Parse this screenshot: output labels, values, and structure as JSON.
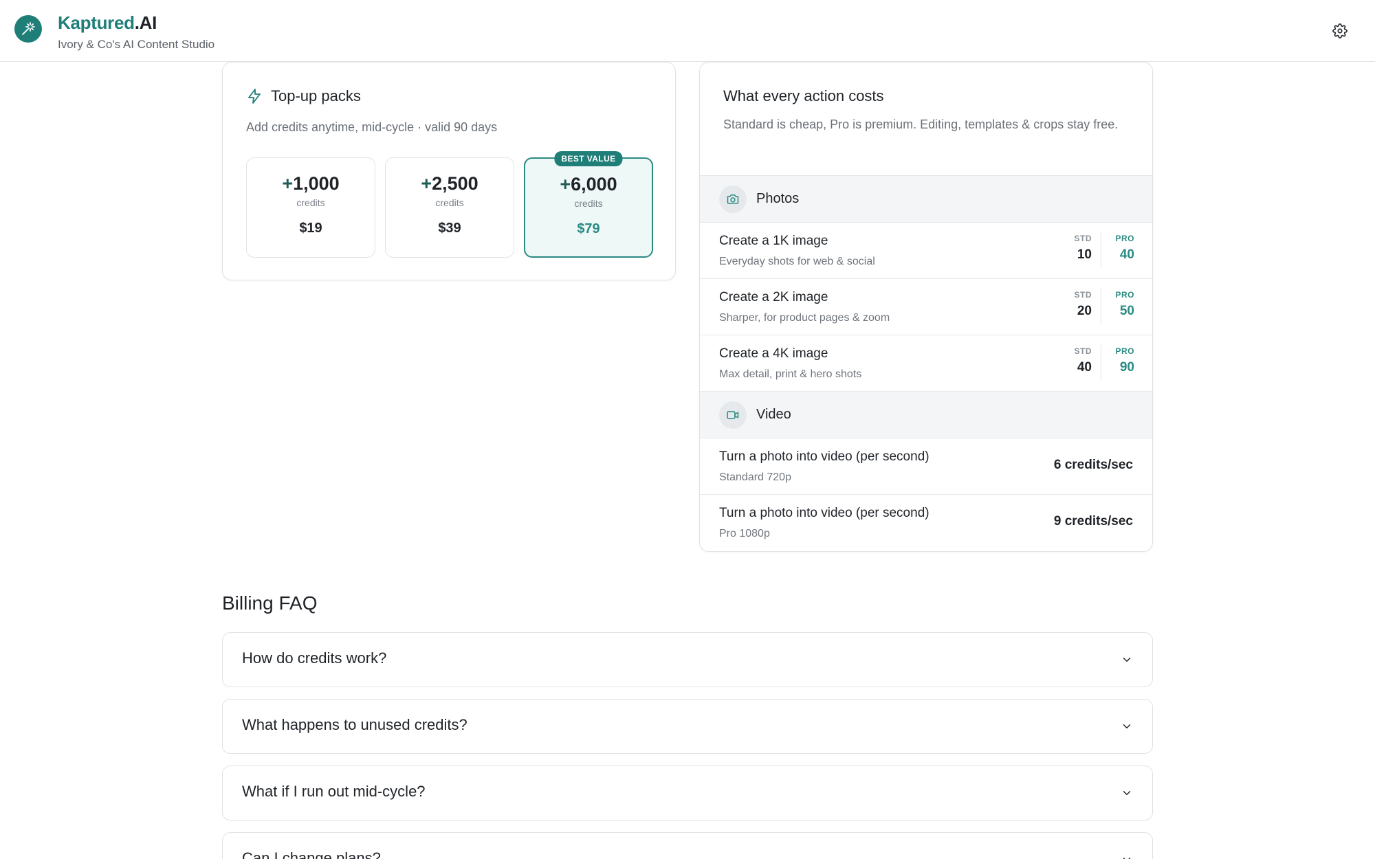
{
  "header": {
    "brand_part1": "Kaptured",
    "brand_part2": ".AI",
    "subtitle": "Ivory & Co's AI Content Studio",
    "logo_icon": "magic-wand-icon",
    "settings_icon": "gear-icon"
  },
  "topup": {
    "title": "Top-up packs",
    "title_icon": "lightning-bolt-icon",
    "subtitle": "Add credits anytime, mid-cycle · valid 90 days",
    "packs": [
      {
        "plus": "+",
        "amount": "1,000",
        "unit": "credits",
        "price": "$19",
        "badge": ""
      },
      {
        "plus": "+",
        "amount": "2,500",
        "unit": "credits",
        "price": "$39",
        "badge": ""
      },
      {
        "plus": "+",
        "amount": "6,000",
        "unit": "credits",
        "price": "$79",
        "badge": "BEST VALUE"
      }
    ]
  },
  "costs": {
    "title": "What every action costs",
    "description": "Standard is cheap, Pro is premium. Editing, templates & crops stay free.",
    "photos": {
      "label": "Photos",
      "icon": "camera-icon",
      "rows": [
        {
          "title": "Create a 1K image",
          "sub": "Everyday shots for web & social",
          "std_label": "STD",
          "std": "10",
          "pro_label": "PRO",
          "pro": "40"
        },
        {
          "title": "Create a 2K image",
          "sub": "Sharper, for product pages & zoom",
          "std_label": "STD",
          "std": "20",
          "pro_label": "PRO",
          "pro": "50"
        },
        {
          "title": "Create a 4K image",
          "sub": "Max detail, print & hero shots",
          "std_label": "STD",
          "std": "40",
          "pro_label": "PRO",
          "pro": "90"
        }
      ]
    },
    "video": {
      "label": "Video",
      "icon": "video-camera-icon",
      "rows": [
        {
          "title": "Turn a photo into video (per second)",
          "sub": "Standard 720p",
          "rate": "6 credits/sec"
        },
        {
          "title": "Turn a photo into video (per second)",
          "sub": "Pro 1080p",
          "rate": "9 credits/sec"
        }
      ]
    }
  },
  "faq": {
    "title": "Billing FAQ",
    "items": [
      {
        "question": "How do credits work?"
      },
      {
        "question": "What happens to unused credits?"
      },
      {
        "question": "What if I run out mid-cycle?"
      },
      {
        "question": "Can I change plans?"
      }
    ]
  },
  "colors": {
    "accent": "#1f7f78",
    "accent_light": "#eef8f7"
  }
}
